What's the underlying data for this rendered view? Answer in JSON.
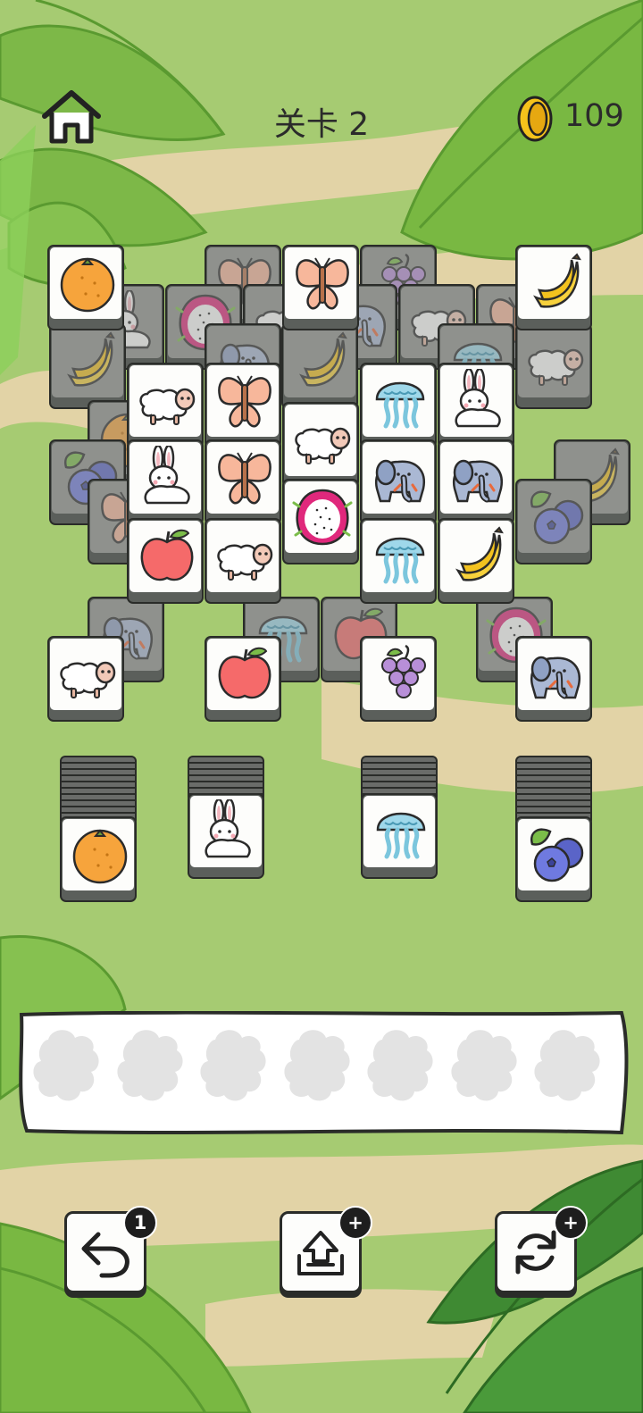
{
  "header": {
    "level_label": "关卡 2",
    "coins": "109",
    "home_icon": "home-icon",
    "coin_icon": "gold-coin-icon"
  },
  "colors": {
    "background": "#a6cb72",
    "tile_face": "#fdfdfb",
    "tile_base": "#5b5f5b",
    "outline": "#2a2c29"
  },
  "board": {
    "top_tiles": [
      "orange",
      "butterfly",
      "banana",
      "sheep",
      "butterfly",
      "jellyfish",
      "rabbit",
      "rabbit",
      "sheep",
      "butterfly",
      "elephant",
      "elephant",
      "apple",
      "sheep",
      "dragonfruit",
      "jellyfish",
      "banana",
      "sheep",
      "apple",
      "grapes",
      "elephant"
    ],
    "covered_tiles": [
      "butterfly",
      "grapes",
      "rabbit",
      "dragonfruit",
      "sheep",
      "elephant",
      "sheep",
      "butterfly",
      "banana",
      "elephant",
      "jellyfish",
      "sheep",
      "banana",
      "orange",
      "blueberry",
      "butterfly",
      "banana",
      "blueberry",
      "elephant",
      "dragonfruit",
      "apple",
      "jellyfish"
    ]
  },
  "stacks": [
    {
      "top": "orange"
    },
    {
      "top": "rabbit"
    },
    {
      "top": "jellyfish"
    },
    {
      "top": "blueberry"
    }
  ],
  "tray": {
    "slot_count": 7,
    "slots": [
      "",
      "",
      "",
      "",
      "",
      "",
      ""
    ]
  },
  "tools": [
    {
      "name": "undo",
      "icon": "undo-icon",
      "badge": "1"
    },
    {
      "name": "move-out",
      "icon": "tray-out-icon",
      "badge": "+"
    },
    {
      "name": "shuffle",
      "icon": "shuffle-icon",
      "badge": "+"
    }
  ]
}
